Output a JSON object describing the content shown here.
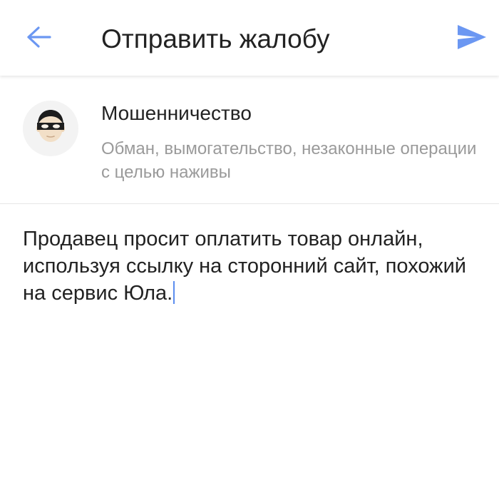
{
  "colors": {
    "accent": "#6b97f2",
    "title_text": "#222222",
    "secondary_text": "#9a9a9a",
    "caret": "#5b8def"
  },
  "header": {
    "back_icon": "arrow-left-icon",
    "title": "Отправить жалобу",
    "send_icon": "send-icon"
  },
  "category": {
    "icon": "masked-bandit-icon",
    "title": "Мошенничество",
    "description": "Обман, вымогательство, незаконные операции с целью наживы"
  },
  "complaint": {
    "text": "Продавец просит оплатить товар онлайн, используя ссылку на сторонний сайт, похожий на сервис Юла."
  }
}
